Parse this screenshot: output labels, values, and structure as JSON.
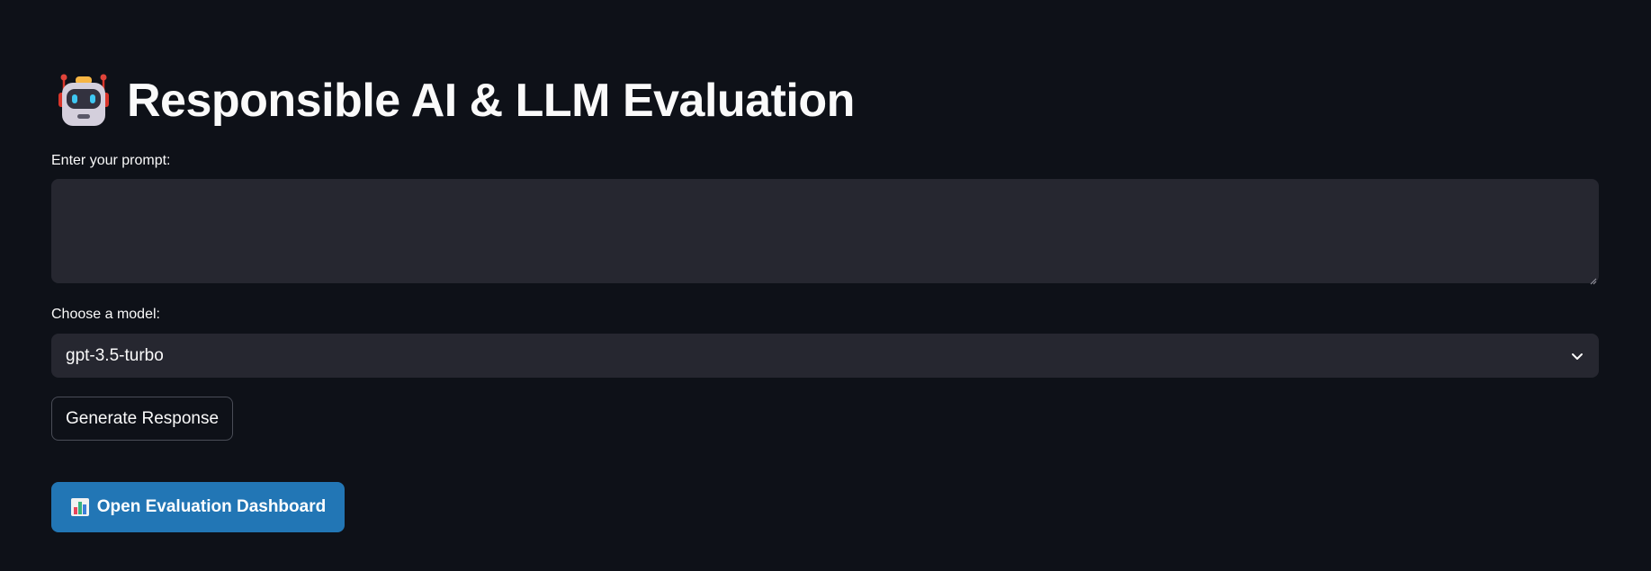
{
  "header": {
    "title": "Responsible AI & LLM Evaluation",
    "icon": "robot-icon"
  },
  "prompt": {
    "label": "Enter your prompt:",
    "value": "",
    "placeholder": ""
  },
  "model": {
    "label": "Choose a model:",
    "selected": "gpt-3.5-turbo",
    "icon": "chevron-down-icon"
  },
  "actions": {
    "generate_label": "Generate Response",
    "dashboard_label": "Open Evaluation Dashboard",
    "dashboard_icon": "bar-chart-icon"
  },
  "colors": {
    "background": "#0e1118",
    "input_bg": "#262730",
    "primary_button": "#2276b5",
    "text": "#fafafa"
  }
}
